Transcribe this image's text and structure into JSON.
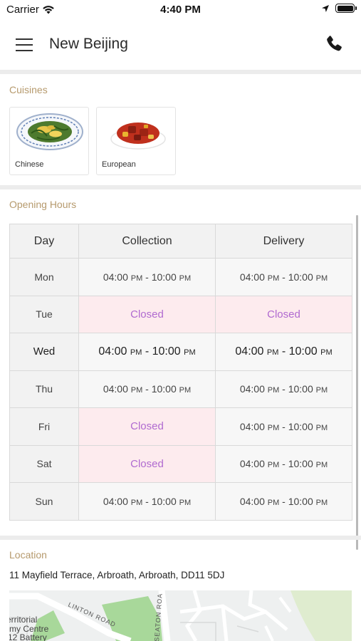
{
  "status_bar": {
    "carrier": "Carrier",
    "time": "4:40 PM"
  },
  "header": {
    "title": "New Beijing"
  },
  "cuisines": {
    "label": "Cuisines",
    "items": [
      {
        "name": "Chinese"
      },
      {
        "name": "European"
      }
    ]
  },
  "opening_hours": {
    "label": "Opening Hours",
    "columns": [
      "Day",
      "Collection",
      "Delivery"
    ],
    "rows": [
      {
        "day": "Mon",
        "collection": {
          "from": "04:00",
          "from_ampm": "PM",
          "to": "10:00",
          "to_ampm": "PM"
        },
        "delivery": {
          "from": "04:00",
          "from_ampm": "PM",
          "to": "10:00",
          "to_ampm": "PM"
        }
      },
      {
        "day": "Tue",
        "collection_closed": "Closed",
        "delivery_closed": "Closed"
      },
      {
        "day": "Wed",
        "collection": {
          "from": "04:00",
          "from_ampm": "PM",
          "to": "10:00",
          "to_ampm": "PM"
        },
        "delivery": {
          "from": "04:00",
          "from_ampm": "PM",
          "to": "10:00",
          "to_ampm": "PM"
        }
      },
      {
        "day": "Thu",
        "collection": {
          "from": "04:00",
          "from_ampm": "PM",
          "to": "10:00",
          "to_ampm": "PM"
        },
        "delivery": {
          "from": "04:00",
          "from_ampm": "PM",
          "to": "10:00",
          "to_ampm": "PM"
        }
      },
      {
        "day": "Fri",
        "collection_closed": "Closed",
        "delivery": {
          "from": "04:00",
          "from_ampm": "PM",
          "to": "10:00",
          "to_ampm": "PM"
        }
      },
      {
        "day": "Sat",
        "collection_closed": "Closed",
        "delivery": {
          "from": "04:00",
          "from_ampm": "PM",
          "to": "10:00",
          "to_ampm": "PM"
        }
      },
      {
        "day": "Sun",
        "collection": {
          "from": "04:00",
          "from_ampm": "PM",
          "to": "10:00",
          "to_ampm": "PM"
        },
        "delivery": {
          "from": "04:00",
          "from_ampm": "PM",
          "to": "10:00",
          "to_ampm": "PM"
        }
      }
    ]
  },
  "location": {
    "label": "Location",
    "address": "11  Mayfield Terrace, Arbroath, Arbroath, DD11 5DJ",
    "map": {
      "labels": [
        "LINTON ROAD",
        "SEATON ROA",
        "erritorial",
        "rmy Centre",
        "12 Battery"
      ]
    }
  },
  "colors": {
    "section_label": "#b69a6d",
    "closed_text": "#b06ad0",
    "closed_bg": "#fdebee",
    "separator": "#ececec"
  },
  "icons": {
    "menu": "hamburger-menu-icon",
    "phone": "phone-icon",
    "wifi": "wifi-icon",
    "location_arrow": "location-arrow-icon",
    "battery": "battery-icon"
  }
}
